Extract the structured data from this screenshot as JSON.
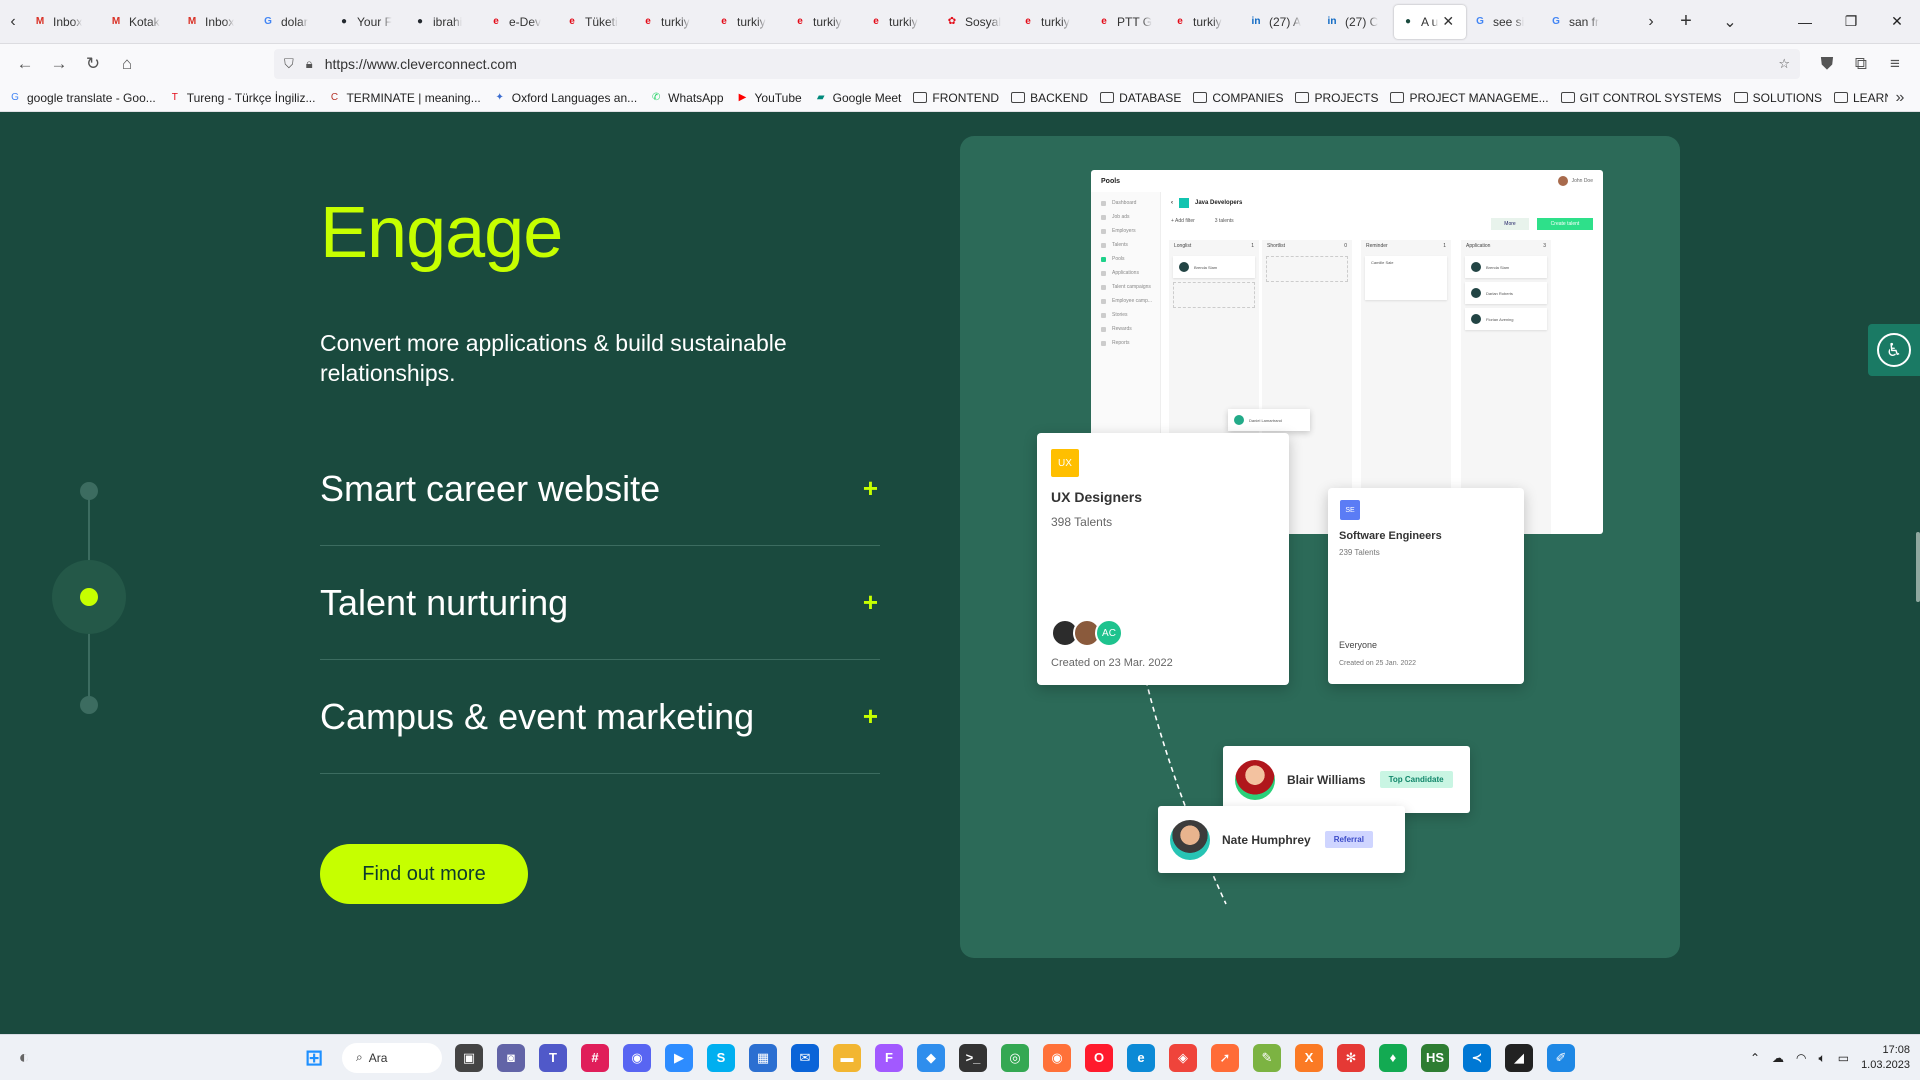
{
  "browser": {
    "tabs": [
      {
        "label": "Inbox",
        "icon": "gmail-icon",
        "color": "#d93025",
        "glyph": "M"
      },
      {
        "label": "Kotak",
        "icon": "gmail-icon",
        "color": "#d93025",
        "glyph": "M"
      },
      {
        "label": "Inbox",
        "icon": "gmail-icon",
        "color": "#d93025",
        "glyph": "M"
      },
      {
        "label": "dolar",
        "icon": "google-icon",
        "color": "#4285f4",
        "glyph": "G"
      },
      {
        "label": "Your F",
        "icon": "github-icon",
        "color": "#24292f",
        "glyph": "●"
      },
      {
        "label": "ibrahi",
        "icon": "github-icon",
        "color": "#24292f",
        "glyph": "●"
      },
      {
        "label": "e-Dev",
        "icon": "edevlet-icon",
        "color": "#e30a17",
        "glyph": "e"
      },
      {
        "label": "Tüketi",
        "icon": "edevlet-icon",
        "color": "#e30a17",
        "glyph": "e"
      },
      {
        "label": "turkiy",
        "icon": "edevlet-icon",
        "color": "#e30a17",
        "glyph": "e"
      },
      {
        "label": "turkiy",
        "icon": "edevlet-icon",
        "color": "#e30a17",
        "glyph": "e"
      },
      {
        "label": "turkiy",
        "icon": "edevlet-icon",
        "color": "#e30a17",
        "glyph": "e"
      },
      {
        "label": "turkiy",
        "icon": "edevlet-icon",
        "color": "#e30a17",
        "glyph": "e"
      },
      {
        "label": "Sosyal",
        "icon": "sgk-icon",
        "color": "#e30a17",
        "glyph": "✿"
      },
      {
        "label": "turkiy",
        "icon": "edevlet-icon",
        "color": "#e30a17",
        "glyph": "e"
      },
      {
        "label": "PTT G",
        "icon": "edevlet-icon",
        "color": "#e30a17",
        "glyph": "e"
      },
      {
        "label": "turkiy",
        "icon": "edevlet-icon",
        "color": "#e30a17",
        "glyph": "e"
      },
      {
        "label": "(27) A",
        "icon": "linkedin-icon",
        "color": "#0a66c2",
        "glyph": "in"
      },
      {
        "label": "(27) C",
        "icon": "linkedin-icon",
        "color": "#0a66c2",
        "glyph": "in"
      },
      {
        "label": "A u",
        "icon": "cleverconnect-icon",
        "color": "#1a4a3e",
        "glyph": "●",
        "active": true
      },
      {
        "label": "see si",
        "icon": "google-icon",
        "color": "#4285f4",
        "glyph": "G"
      },
      {
        "label": "san fr",
        "icon": "google-icon",
        "color": "#4285f4",
        "glyph": "G"
      }
    ],
    "url": "https://www.cleverconnect.com",
    "bookmarks": [
      {
        "label": "google translate - Goo...",
        "type": "site",
        "color": "#4285f4",
        "glyph": "G"
      },
      {
        "label": "Tureng - Türkçe İngiliz...",
        "type": "site",
        "color": "#e30a17",
        "glyph": "T"
      },
      {
        "label": "TERMINATE | meaning...",
        "type": "site",
        "color": "#b5342a",
        "glyph": "C"
      },
      {
        "label": "Oxford Languages an...",
        "type": "site",
        "color": "#3b6ccf",
        "glyph": "✦"
      },
      {
        "label": "WhatsApp",
        "type": "site",
        "color": "#25d366",
        "glyph": "✆"
      },
      {
        "label": "YouTube",
        "type": "site",
        "color": "#ff0000",
        "glyph": "▶"
      },
      {
        "label": "Google Meet",
        "type": "site",
        "color": "#00897b",
        "glyph": "▰"
      },
      {
        "label": "FRONTEND",
        "type": "folder"
      },
      {
        "label": "BACKEND",
        "type": "folder"
      },
      {
        "label": "DATABASE",
        "type": "folder"
      },
      {
        "label": "COMPANIES",
        "type": "folder"
      },
      {
        "label": "PROJECTS",
        "type": "folder"
      },
      {
        "label": "PROJECT MANAGEME...",
        "type": "folder"
      },
      {
        "label": "GIT CONTROL SYSTEMS",
        "type": "folder"
      },
      {
        "label": "SOLUTIONS",
        "type": "folder"
      },
      {
        "label": "LEARNING",
        "type": "folder"
      }
    ]
  },
  "hero": {
    "title": "Engage",
    "subtitle": "Convert more applications & build sustainable relationships.",
    "cta": "Find out more"
  },
  "accordion": [
    {
      "label": "Smart career website",
      "expand": "+"
    },
    {
      "label": "Talent nurturing",
      "expand": "+"
    },
    {
      "label": "Campus & event marketing",
      "expand": "+"
    }
  ],
  "showcase": {
    "dashboard": {
      "title": "Pools",
      "user": "John Doe",
      "pool_name": "Java Developers",
      "add_filter": "+ Add filter",
      "talents_count": "3 talents",
      "more": "More",
      "create": "Create talent",
      "sidebar": [
        "Dashboard",
        "Job ads",
        "Employers",
        "Talents",
        "Pools",
        "Applications",
        "Talent campaigns",
        "Employee camp...",
        "Stories",
        "Rewards",
        "Reports"
      ],
      "columns": [
        {
          "name": "Longlist",
          "count": "1",
          "cards": [
            "Brenda Slam"
          ]
        },
        {
          "name": "Shortlist",
          "count": "0",
          "cards": []
        },
        {
          "name": "Reminder",
          "count": "1",
          "cards": [
            "Camille Sale"
          ]
        },
        {
          "name": "Application",
          "count": "3",
          "cards": [
            "Brenda Slam",
            "Darlan Roberts",
            "Florian Avening"
          ]
        }
      ],
      "floating_card": "Daniel Lamartrand"
    },
    "ux_card": {
      "badge": "UX",
      "badge_color": "#ffbf00",
      "title": "UX Designers",
      "count": "398 Talents",
      "avatar_initials": "AC",
      "created": "Created on 23 Mar. 2022"
    },
    "se_card": {
      "badge": "SE",
      "badge_color": "#5b7cf5",
      "title": "Software Engineers",
      "count": "239 Talents",
      "audience": "Everyone",
      "created": "Created on 25 Jan. 2022"
    },
    "people": [
      {
        "name": "Blair Williams",
        "tag": "Top Candidate",
        "tag_bg": "#c9f5e3",
        "tag_color": "#11866a"
      },
      {
        "name": "Nate Humphrey",
        "tag": "Referral",
        "tag_bg": "#cfd5ff",
        "tag_color": "#3a4ac8"
      }
    ]
  },
  "taskbar": {
    "search": "Ara",
    "apps": [
      {
        "name": "windows-start-icon",
        "color": "#1e90ff",
        "glyph": "⊞"
      },
      {
        "name": "task-view-icon",
        "color": "#444",
        "glyph": "▣"
      },
      {
        "name": "teams-chat-icon",
        "color": "#6264a7",
        "glyph": "◙"
      },
      {
        "name": "teams-icon",
        "color": "#5059c9",
        "glyph": "T"
      },
      {
        "name": "slack-icon",
        "color": "#e01e5a",
        "glyph": "#"
      },
      {
        "name": "discord-icon",
        "color": "#5865f2",
        "glyph": "◉"
      },
      {
        "name": "zoom-icon",
        "color": "#2d8cff",
        "glyph": "▶"
      },
      {
        "name": "skype-icon",
        "color": "#00aff0",
        "glyph": "S"
      },
      {
        "name": "store-icon",
        "color": "#2b6fd1",
        "glyph": "▦"
      },
      {
        "name": "mail-icon",
        "color": "#0a64d8",
        "glyph": "✉"
      },
      {
        "name": "explorer-icon",
        "color": "#f2b632",
        "glyph": "▬"
      },
      {
        "name": "figma-icon",
        "color": "#a259ff",
        "glyph": "F"
      },
      {
        "name": "sourcetree-icon",
        "color": "#2f8eed",
        "glyph": "◆"
      },
      {
        "name": "terminal-icon",
        "color": "#333",
        "glyph": ">_"
      },
      {
        "name": "chrome-icon",
        "color": "#34a853",
        "glyph": "◎"
      },
      {
        "name": "firefox-icon",
        "color": "#ff7139",
        "glyph": "◉"
      },
      {
        "name": "opera-icon",
        "color": "#ff1b2d",
        "glyph": "O"
      },
      {
        "name": "edge-icon",
        "color": "#0c8ad6",
        "glyph": "e"
      },
      {
        "name": "anydesk-icon",
        "color": "#ef443b",
        "glyph": "◈"
      },
      {
        "name": "postman-icon",
        "color": "#ff6c37",
        "glyph": "➚"
      },
      {
        "name": "notepad-icon",
        "color": "#7cb342",
        "glyph": "✎"
      },
      {
        "name": "xampp-icon",
        "color": "#fb7a24",
        "glyph": "X"
      },
      {
        "name": "cluster-icon",
        "color": "#e53935",
        "glyph": "✻"
      },
      {
        "name": "mongodb-icon",
        "color": "#13aa52",
        "glyph": "♦"
      },
      {
        "name": "heidisql-icon",
        "color": "#2e7d32",
        "glyph": "HS"
      },
      {
        "name": "vscode-icon",
        "color": "#0078d4",
        "glyph": "≺"
      },
      {
        "name": "vscode-icon-2",
        "color": "#222",
        "glyph": "◢"
      },
      {
        "name": "paint-icon",
        "color": "#1e88e5",
        "glyph": "✐"
      }
    ],
    "time": "17:08",
    "date": "1.03.2023"
  }
}
